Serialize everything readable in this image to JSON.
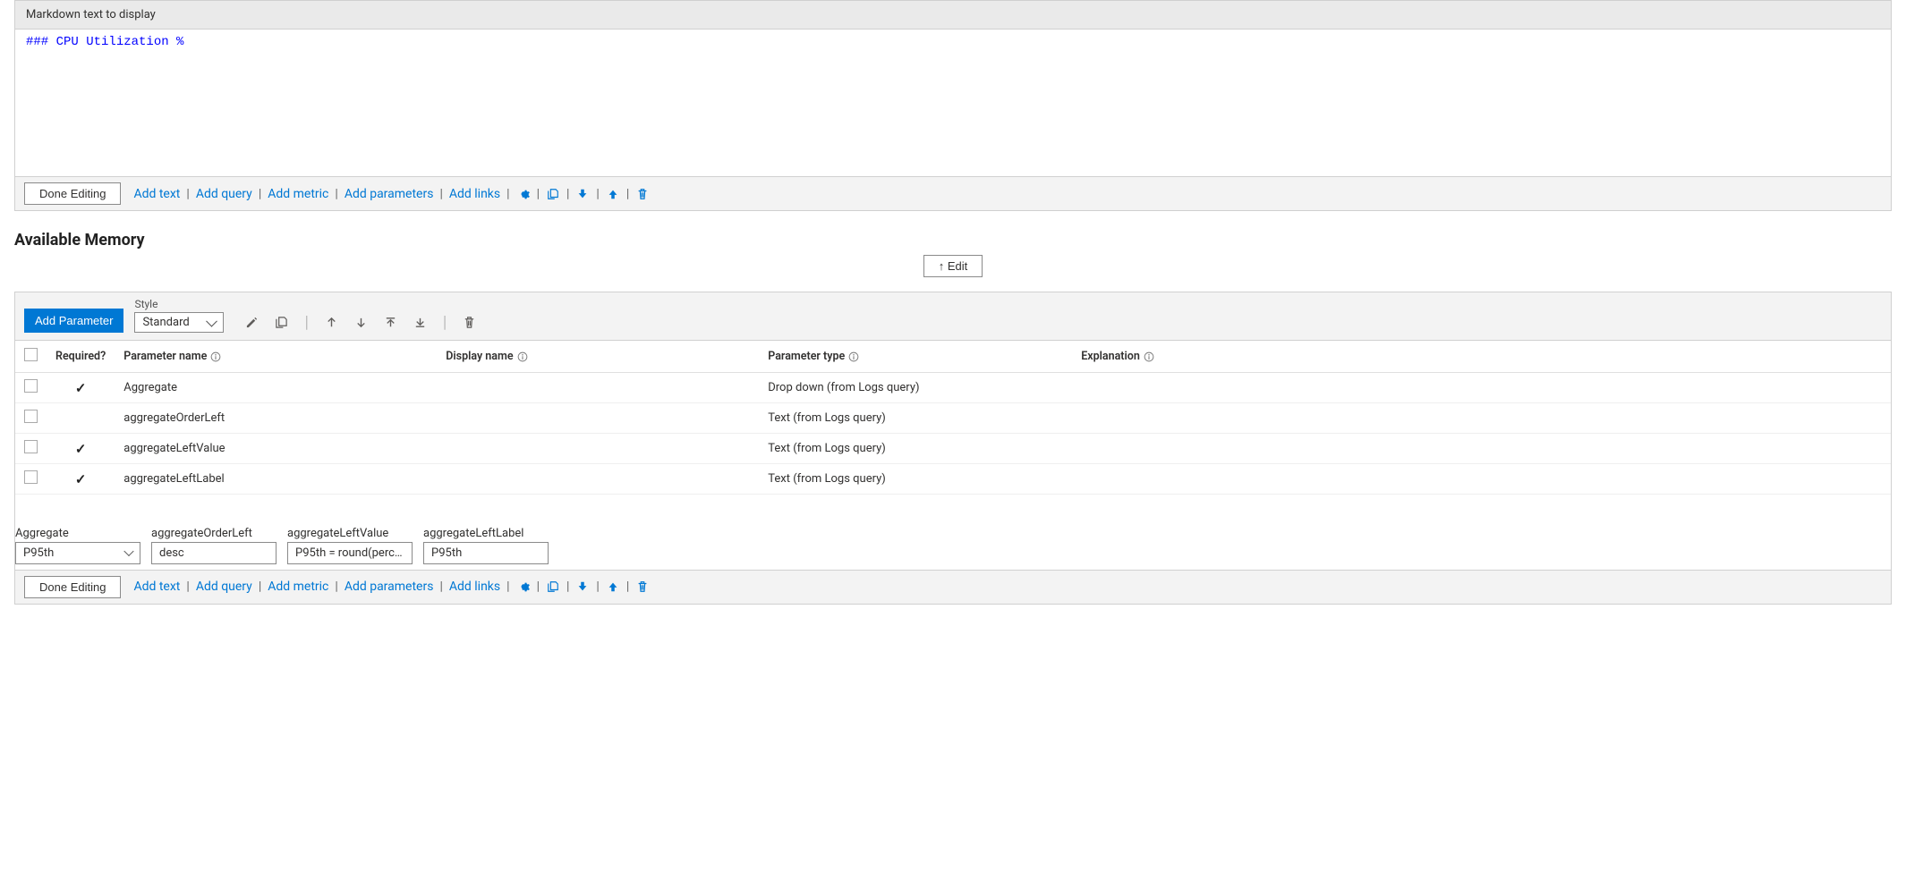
{
  "markdown_panel": {
    "header": "Markdown text to display",
    "content": "### CPU Utilization %",
    "done_editing": "Done Editing"
  },
  "footer_actions": {
    "add_text": "Add text",
    "add_query": "Add query",
    "add_metric": "Add metric",
    "add_parameters": "Add parameters",
    "add_links": "Add links"
  },
  "section": {
    "title": "Available Memory",
    "edit_btn": "↑ Edit"
  },
  "params_panel": {
    "add_parameter": "Add Parameter",
    "style_label": "Style",
    "style_value": "Standard",
    "headers": {
      "required": "Required?",
      "name": "Parameter name",
      "display": "Display name",
      "type": "Parameter type",
      "explanation": "Explanation"
    },
    "rows": [
      {
        "required": true,
        "name": "Aggregate",
        "display": "",
        "type": "Drop down (from Logs query)",
        "explanation": ""
      },
      {
        "required": false,
        "name": "aggregateOrderLeft",
        "display": "",
        "type": "Text (from Logs query)",
        "explanation": ""
      },
      {
        "required": true,
        "name": "aggregateLeftValue",
        "display": "",
        "type": "Text (from Logs query)",
        "explanation": ""
      },
      {
        "required": true,
        "name": "aggregateLeftLabel",
        "display": "",
        "type": "Text (from Logs query)",
        "explanation": ""
      }
    ],
    "preview": {
      "Aggregate": {
        "label": "Aggregate",
        "value": "P95th"
      },
      "aggregateOrderLeft": {
        "label": "aggregateOrderLeft",
        "value": "desc"
      },
      "aggregateLeftValue": {
        "label": "aggregateLeftValue",
        "value": "P95th = round(percenti…"
      },
      "aggregateLeftLabel": {
        "label": "aggregateLeftLabel",
        "value": "P95th"
      }
    },
    "done_editing": "Done Editing"
  }
}
